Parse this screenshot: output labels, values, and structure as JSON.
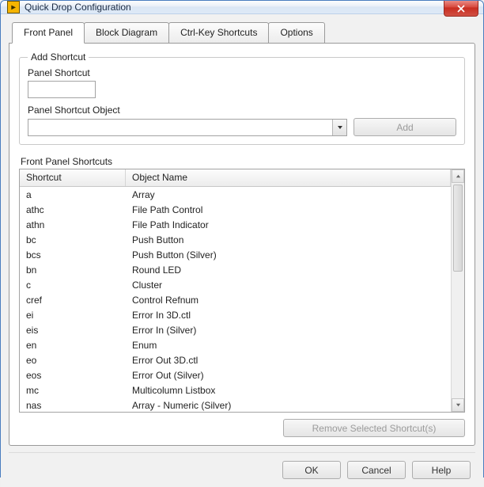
{
  "window": {
    "title": "Quick Drop Configuration",
    "icon_name": "labview-icon"
  },
  "tabs": [
    {
      "label": "Front Panel",
      "active": true
    },
    {
      "label": "Block Diagram",
      "active": false
    },
    {
      "label": "Ctrl-Key Shortcuts",
      "active": false
    },
    {
      "label": "Options",
      "active": false
    }
  ],
  "add_shortcut": {
    "group_title": "Add Shortcut",
    "panel_shortcut_label": "Panel Shortcut",
    "panel_shortcut_value": "",
    "panel_shortcut_object_label": "Panel Shortcut Object",
    "combo_value": "",
    "add_label": "Add"
  },
  "shortcuts_section_label": "Front Panel Shortcuts",
  "columns": {
    "shortcut": "Shortcut",
    "object": "Object Name"
  },
  "rows": [
    {
      "shortcut": "a",
      "object": "Array"
    },
    {
      "shortcut": "athc",
      "object": "File Path Control"
    },
    {
      "shortcut": "athn",
      "object": "File Path Indicator"
    },
    {
      "shortcut": "bc",
      "object": "Push Button"
    },
    {
      "shortcut": "bcs",
      "object": "Push Button (Silver)"
    },
    {
      "shortcut": "bn",
      "object": "Round LED"
    },
    {
      "shortcut": "c",
      "object": "Cluster"
    },
    {
      "shortcut": "cref",
      "object": "Control Refnum"
    },
    {
      "shortcut": "ei",
      "object": "Error In 3D.ctl"
    },
    {
      "shortcut": "eis",
      "object": "Error In  (Silver)"
    },
    {
      "shortcut": "en",
      "object": "Enum"
    },
    {
      "shortcut": "eo",
      "object": "Error Out 3D.ctl"
    },
    {
      "shortcut": "eos",
      "object": "Error Out (Silver)"
    },
    {
      "shortcut": "mc",
      "object": "Multicolumn Listbox"
    },
    {
      "shortcut": "nas",
      "object": "Array - Numeric (Silver)"
    }
  ],
  "remove_label": "Remove Selected Shortcut(s)",
  "dialog_buttons": {
    "ok": "OK",
    "cancel": "Cancel",
    "help": "Help"
  }
}
